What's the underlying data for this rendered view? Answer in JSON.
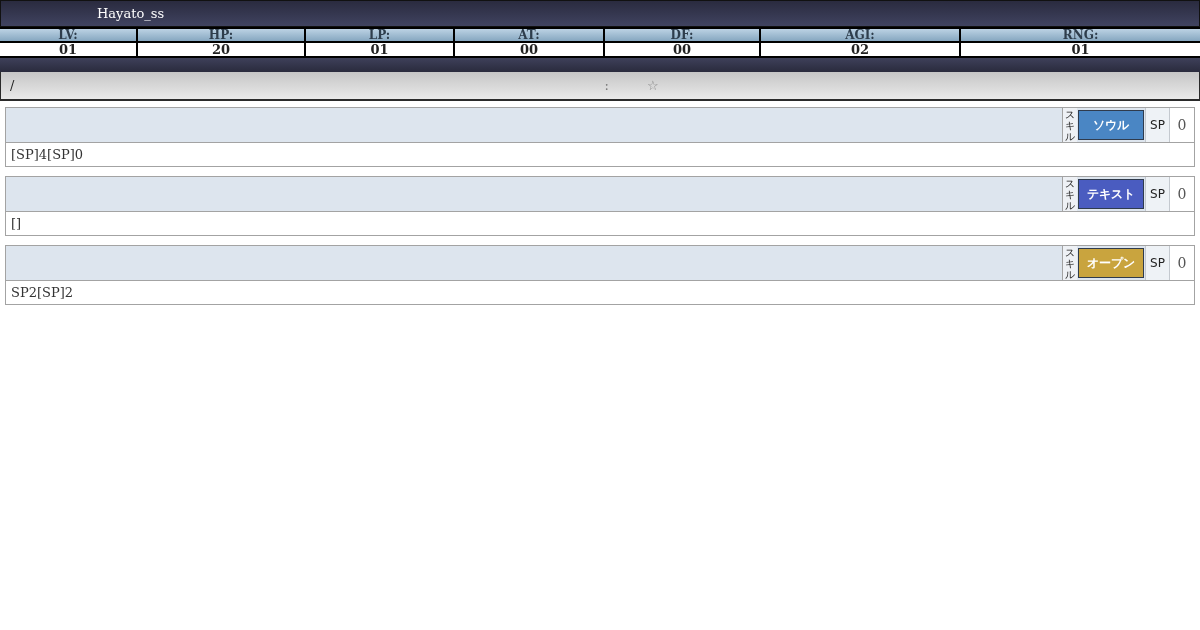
{
  "header": {
    "name": "Hayato_ss"
  },
  "stats": [
    {
      "label": "LV:",
      "value": "01"
    },
    {
      "label": "HP:",
      "value": "20"
    },
    {
      "label": "LP:",
      "value": "01"
    },
    {
      "label": "AT:",
      "value": "00"
    },
    {
      "label": "DF:",
      "value": "00"
    },
    {
      "label": "AGI:",
      "value": "02"
    },
    {
      "label": "RNG:",
      "value": "01"
    }
  ],
  "info_bar": {
    "slash": "/",
    "colon": ":",
    "star": "☆"
  },
  "skills": [
    {
      "skill_label": "スキル",
      "type_button": "ソウル",
      "color": "#4a86c4",
      "sp_label": "SP",
      "sp_value": "0",
      "description": "[SP]4[SP]0"
    },
    {
      "skill_label": "スキル",
      "type_button": "テキスト",
      "color": "#4a5cc0",
      "sp_label": "SP",
      "sp_value": "0",
      "description": "[]"
    },
    {
      "skill_label": "スキル",
      "type_button": "オープン",
      "color": "#c9a43e",
      "sp_label": "SP",
      "sp_value": "0",
      "description": "SP2[SP]2"
    }
  ]
}
